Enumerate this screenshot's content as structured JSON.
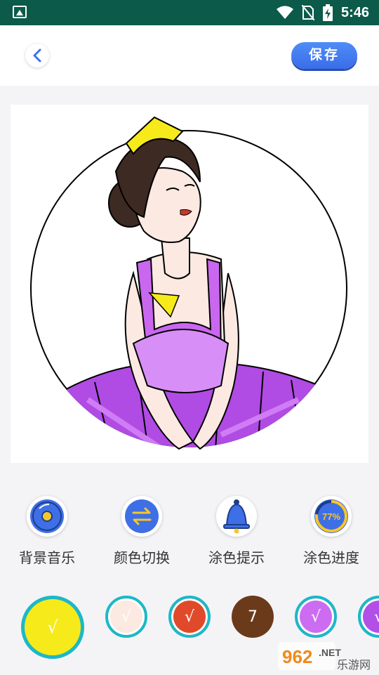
{
  "status_bar": {
    "time": "5:46"
  },
  "header": {
    "save_label": "保存"
  },
  "tools": [
    {
      "label": "背景音乐"
    },
    {
      "label": "颜色切换"
    },
    {
      "label": "涂色提示"
    },
    {
      "label": "涂色进度",
      "progress_text": "77%",
      "progress": 0.77
    }
  ],
  "palette": [
    {
      "color": "#f7ea1a",
      "mark": "√",
      "selected": true
    },
    {
      "color": "#fbe9e2",
      "mark": "√"
    },
    {
      "color": "#e04a2a",
      "mark": "√"
    },
    {
      "color": "#6b3a1b",
      "mark": "7"
    },
    {
      "color": "#cc6cf0",
      "mark": "√"
    },
    {
      "color": "#b24fe6",
      "mark": "√"
    }
  ],
  "watermark": {
    "number": "962",
    "domain": ".NET",
    "site": "乐游网"
  },
  "colors": {
    "accent": "#3d72ea",
    "statusbar": "#0b5a4a",
    "ring": "#1cb8c8"
  }
}
